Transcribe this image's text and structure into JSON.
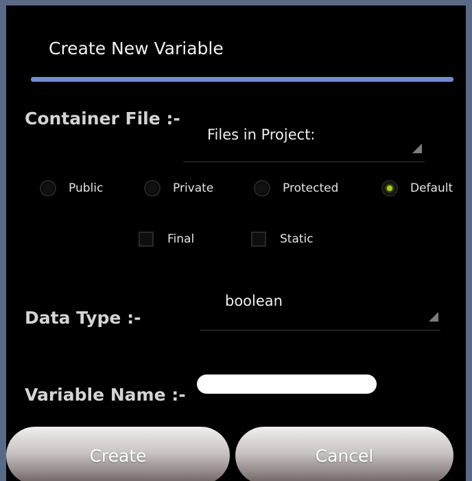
{
  "dialog": {
    "title": "Create New Variable"
  },
  "container_file": {
    "label": "Container File :-",
    "spinner_value": "Files in Project:"
  },
  "access_modifiers": [
    {
      "label": "Public",
      "selected": false
    },
    {
      "label": "Private",
      "selected": false
    },
    {
      "label": "Protected",
      "selected": false
    },
    {
      "label": "Default",
      "selected": true
    }
  ],
  "modifiers": [
    {
      "label": "Final",
      "checked": false
    },
    {
      "label": "Static",
      "checked": false
    }
  ],
  "data_type": {
    "label": "Data Type :-",
    "spinner_value": "boolean"
  },
  "variable_name": {
    "label": "Variable Name :-",
    "value": ""
  },
  "buttons": {
    "create": "Create",
    "cancel": "Cancel"
  },
  "colors": {
    "accent_bar": "#6f8ed2",
    "radio_selected": "#a4d21f",
    "background": "#000000"
  }
}
